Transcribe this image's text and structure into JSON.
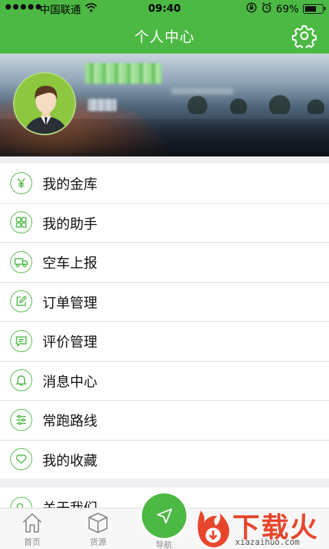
{
  "status_bar": {
    "carrier": "中国联通",
    "time": "09:40",
    "battery": "69%",
    "battery_level": 0.69
  },
  "header": {
    "title": "个人中心",
    "settings_icon": "gear-icon"
  },
  "colors": {
    "brand_green": "#4cb944",
    "watermark_red": "#e8462c"
  },
  "menu": {
    "items": [
      {
        "label": "我的金库",
        "icon": "yen-icon"
      },
      {
        "label": "我的助手",
        "icon": "grid-icon"
      },
      {
        "label": "空车上报",
        "icon": "truck-icon"
      },
      {
        "label": "订单管理",
        "icon": "edit-icon"
      },
      {
        "label": "评价管理",
        "icon": "comment-icon"
      },
      {
        "label": "消息中心",
        "icon": "bell-icon"
      },
      {
        "label": "常跑路线",
        "icon": "sliders-icon"
      },
      {
        "label": "我的收藏",
        "icon": "heart-icon"
      }
    ],
    "more_items": [
      {
        "label": "关于我们",
        "icon": "info-icon"
      }
    ]
  },
  "tab_bar": {
    "tabs": [
      {
        "label": "首页",
        "icon": "home-icon"
      },
      {
        "label": "货源",
        "icon": "box-icon"
      },
      {
        "label": "导航",
        "icon": "navigation-icon"
      }
    ]
  },
  "watermark": {
    "brand": "下载火",
    "domain": "xiazaihuo.com"
  }
}
